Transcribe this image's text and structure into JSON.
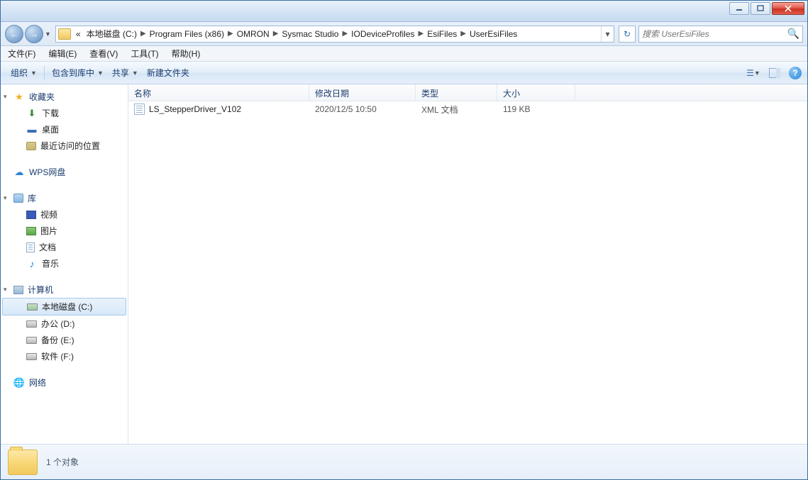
{
  "breadcrumbs": {
    "prefix": "«",
    "items": [
      "本地磁盘 (C:)",
      "Program Files (x86)",
      "OMRON",
      "Sysmac Studio",
      "IODeviceProfiles",
      "EsiFiles",
      "UserEsiFiles"
    ]
  },
  "search": {
    "placeholder": "搜索 UserEsiFiles"
  },
  "menu": {
    "file": "文件(F)",
    "edit": "编辑(E)",
    "view": "查看(V)",
    "tools": "工具(T)",
    "help": "帮助(H)"
  },
  "toolbar": {
    "organize": "组织",
    "include": "包含到库中",
    "share": "共享",
    "newfolder": "新建文件夹"
  },
  "sidebar": {
    "favorites": {
      "label": "收藏夹",
      "items": [
        {
          "label": "下载"
        },
        {
          "label": "桌面"
        },
        {
          "label": "最近访问的位置"
        }
      ]
    },
    "wps": {
      "label": "WPS网盘"
    },
    "libraries": {
      "label": "库",
      "items": [
        {
          "label": "视频"
        },
        {
          "label": "图片"
        },
        {
          "label": "文档"
        },
        {
          "label": "音乐"
        }
      ]
    },
    "computer": {
      "label": "计算机",
      "items": [
        {
          "label": "本地磁盘 (C:)",
          "selected": true
        },
        {
          "label": "办公 (D:)"
        },
        {
          "label": "备份 (E:)"
        },
        {
          "label": "软件 (F:)"
        }
      ]
    },
    "network": {
      "label": "网络"
    }
  },
  "columns": {
    "name": "名称",
    "date": "修改日期",
    "type": "类型",
    "size": "大小"
  },
  "files": [
    {
      "name": "LS_StepperDriver_V102",
      "date": "2020/12/5 10:50",
      "type": "XML 文档",
      "size": "119 KB"
    }
  ],
  "status": {
    "count": "1 个对象"
  }
}
